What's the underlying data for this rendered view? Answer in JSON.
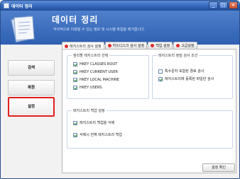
{
  "window": {
    "title": "데이터 정리"
  },
  "header": {
    "title": "데이터 정리",
    "subtitle": "악의적으로 이용될 수 있는 정보 및 시스템 파일을 제거합니다."
  },
  "sidebar": {
    "items": [
      {
        "label": "검색"
      },
      {
        "label": "복원"
      },
      {
        "label": "설정"
      }
    ]
  },
  "tabs": [
    {
      "label": "레지스트리 검사 설정"
    },
    {
      "label": "하드디스크 검사 설정"
    },
    {
      "label": "백업 설정"
    },
    {
      "label": "고급설정"
    }
  ],
  "groups": {
    "registry_select": {
      "title": "정리할 레지스트리 선택",
      "items": [
        {
          "label": "HKEY CLASSES ROOT",
          "checked": true
        },
        {
          "label": "HKEY CURRENT USER",
          "checked": true
        },
        {
          "label": "HKEY LOCAL MACHINE",
          "checked": true
        },
        {
          "label": "HKEY USERS",
          "checked": true
        }
      ]
    },
    "registry_conditions": {
      "title": "레지스트리 정밀 검사 조건",
      "items": [
        {
          "label": "특수문자 포함된 경로 검사",
          "checked": false
        },
        {
          "label": "레지스트리에 등록된 파일만 검사",
          "checked": true
        }
      ]
    },
    "registry_backup": {
      "title": "레지스트리 백업 설정",
      "items": [
        {
          "label": "레지스트리 백업을 삭제",
          "checked": true
        },
        {
          "label": "삭제시 전체 레지스트리 백업",
          "checked": true
        }
      ]
    }
  },
  "footer": {
    "confirm_label": "설정 확인"
  },
  "colors": {
    "header_blue": "#3a6bbd",
    "active_highlight": "#e32020",
    "check_green": "#2b8a2b"
  }
}
